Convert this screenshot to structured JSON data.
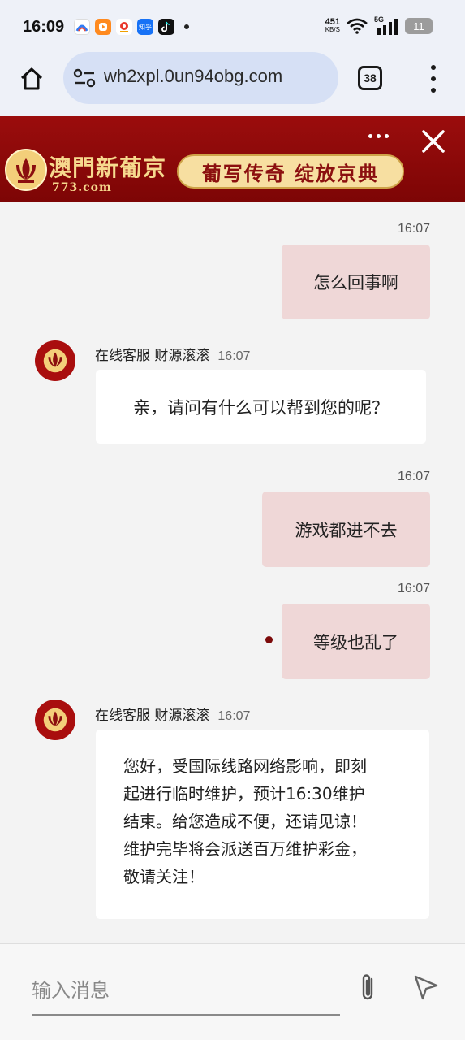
{
  "status_bar": {
    "time": "16:09",
    "speed_value": "451",
    "speed_unit": "KB/S",
    "network": "5G",
    "battery": "11",
    "notification_icons": [
      "app-icon-1",
      "video-app-icon",
      "map-pin-app-icon",
      "zhihu-icon",
      "tiktok-icon"
    ]
  },
  "browser": {
    "url": "wh2xpl.0un94obg.com",
    "tab_count": "38"
  },
  "banner": {
    "brand_name": "澳門新葡京",
    "brand_url": "773.com",
    "slogan": "葡写传奇 绽放京典",
    "colors": {
      "background": "#8b0808",
      "gold": "#f6d98e"
    }
  },
  "chat": {
    "agent_name": "在线客服 财源滚滚",
    "messages": [
      {
        "from": "me",
        "time": "16:07",
        "text": "怎么回事啊"
      },
      {
        "from": "agent",
        "time": "16:07",
        "text": "亲，请问有什么可以帮到您的呢？"
      },
      {
        "from": "me",
        "time": "16:07",
        "text": "游戏都进不去"
      },
      {
        "from": "me",
        "time": "16:07",
        "text": "等级也乱了"
      },
      {
        "from": "agent",
        "time": "16:07",
        "lines": [
          "您好，受国际线路网络影响，即刻",
          "起进行临时维护，预计16:30维护",
          "结束。给您造成不便，还请见谅！",
          "维护完毕将会派送百万维护彩金，",
          "敬请关注！"
        ]
      }
    ]
  },
  "input": {
    "placeholder": "输入消息"
  },
  "theme": {
    "my_bubble": "#efd7d7",
    "agent_bubble": "#ffffff",
    "accent": "#7c0a0a"
  }
}
